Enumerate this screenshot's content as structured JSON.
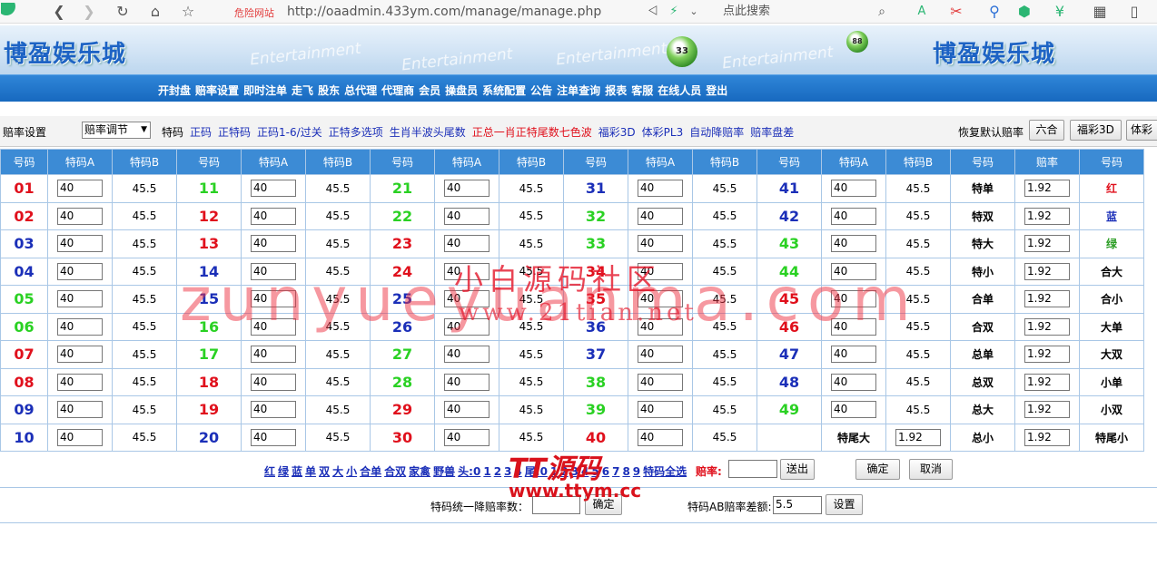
{
  "browser": {
    "danger": "危险网站",
    "url": "http://oaadmin.433ym.com/manage/manage.php",
    "search_placeholder": "点此搜索"
  },
  "site": {
    "title_left": "博盈娱乐城",
    "title_right": "博盈娱乐城",
    "banner_text": "Entertainment"
  },
  "nav": [
    "开封盘",
    "赔率设置",
    "即时注单",
    "走飞",
    "股东",
    "总代理",
    "代理商",
    "会员",
    "操盘员",
    "系统配置",
    "公告",
    "注单查询",
    "报表",
    "客服",
    "在线人员",
    "登出"
  ],
  "settings": {
    "label": "赔率设置",
    "select_value": "赔率调节",
    "categories": [
      {
        "text": "特码",
        "color": "#000000"
      },
      {
        "text": "正码",
        "color": "#1b2fb8"
      },
      {
        "text": "正特码",
        "color": "#1b2fb8"
      },
      {
        "text": "正码1-6/过关",
        "color": "#1b2fb8"
      },
      {
        "text": "正特多选项",
        "color": "#1b2fb8"
      },
      {
        "text": "生肖半波头尾数",
        "color": "#1b2fb8"
      },
      {
        "text": "正总一肖正特尾数七色波",
        "color": "#e0101c"
      },
      {
        "text": "福彩3D",
        "color": "#1b2fb8"
      },
      {
        "text": "体彩PL3",
        "color": "#1b2fb8"
      },
      {
        "text": "自动降赔率",
        "color": "#1b2fb8"
      },
      {
        "text": "赔率盘差",
        "color": "#1b2fb8"
      }
    ],
    "restore_label": "恢复默认赔率",
    "btn_liuhe": "六合",
    "btn_fucai": "福彩3D",
    "btn_ticai": "体彩"
  },
  "table": {
    "headers": [
      "号码",
      "特码A",
      "特码B",
      "号码",
      "特码A",
      "特码B",
      "号码",
      "特码A",
      "特码B",
      "号码",
      "特码A",
      "特码B",
      "号码",
      "特码A",
      "特码B",
      "号码",
      "赔率",
      "号码"
    ],
    "columns": [
      {
        "nums": [
          "01",
          "02",
          "03",
          "04",
          "05",
          "06",
          "07",
          "08",
          "09",
          "10"
        ],
        "colors": [
          "red",
          "red",
          "blue",
          "blue",
          "green",
          "green",
          "red",
          "red",
          "blue",
          "blue"
        ]
      },
      {
        "nums": [
          "11",
          "12",
          "13",
          "14",
          "15",
          "16",
          "17",
          "18",
          "19",
          "20"
        ],
        "colors": [
          "green",
          "red",
          "red",
          "blue",
          "blue",
          "green",
          "green",
          "red",
          "red",
          "blue"
        ]
      },
      {
        "nums": [
          "21",
          "22",
          "23",
          "24",
          "25",
          "26",
          "27",
          "28",
          "29",
          "30"
        ],
        "colors": [
          "green",
          "green",
          "red",
          "red",
          "blue",
          "blue",
          "green",
          "green",
          "red",
          "red"
        ]
      },
      {
        "nums": [
          "31",
          "32",
          "33",
          "34",
          "35",
          "36",
          "37",
          "38",
          "39",
          "40"
        ],
        "colors": [
          "blue",
          "green",
          "green",
          "red",
          "red",
          "blue",
          "blue",
          "green",
          "green",
          "red"
        ]
      },
      {
        "nums": [
          "41",
          "42",
          "43",
          "44",
          "45",
          "46",
          "47",
          "48",
          "49",
          ""
        ],
        "colors": [
          "blue",
          "blue",
          "green",
          "green",
          "red",
          "red",
          "blue",
          "blue",
          "green",
          ""
        ]
      }
    ],
    "a_value": "40",
    "b_value": "45.5",
    "extra_last_row": {
      "label": "特尾大",
      "odds": "1.92"
    },
    "side_labels": [
      "特单",
      "特双",
      "特大",
      "特小",
      "合单",
      "合双",
      "总单",
      "总双",
      "总大",
      "总小"
    ],
    "side_odds": [
      "1.92",
      "1.92",
      "1.92",
      "1.92",
      "1.92",
      "1.92",
      "1.92",
      "1.92",
      "1.92",
      "1.92"
    ],
    "wave": [
      {
        "text": "红",
        "color": "#e0101c"
      },
      {
        "text": "蓝",
        "color": "#1b2fb8"
      },
      {
        "text": "绿",
        "color": "#2a9d23"
      },
      {
        "text": "合大",
        "color": "#000000"
      },
      {
        "text": "合小",
        "color": "#000000"
      },
      {
        "text": "大单",
        "color": "#000000"
      },
      {
        "text": "大双",
        "color": "#000000"
      },
      {
        "text": "小单",
        "color": "#000000"
      },
      {
        "text": "小双",
        "color": "#000000"
      },
      {
        "text": "特尾小",
        "color": "#000000"
      }
    ]
  },
  "quick": {
    "links": [
      "红",
      "绿",
      "蓝",
      "单",
      "双",
      "大",
      "小",
      "合单",
      "合双",
      "家禽",
      "野兽",
      "头:0",
      "1",
      "2",
      "3",
      "4",
      "尾:0",
      "1",
      "2",
      "3",
      "4",
      "5",
      "6",
      "7",
      "8",
      "9",
      "特码全选"
    ],
    "odds_label": "赔率:",
    "send": "送出",
    "confirm": "确定",
    "cancel": "取消"
  },
  "bottom": {
    "lower_label": "特码统一降赔率数：",
    "lower_confirm": "确定",
    "diff_label": "特码AB赔率差额:",
    "diff_value": "5.5",
    "set": "设置"
  },
  "watermarks": {
    "big": "zunyueyuanma.com",
    "cn": "小白源码社区",
    "url": "www.21tian.net",
    "tt": "TT源码",
    "tt_url": "www.ttym.cc"
  },
  "colors": {
    "red": "#e0101c",
    "blue": "#1b2fb8",
    "green": "#2ad123",
    "header": "#3c8bd5",
    "nav": "#1769bf"
  }
}
